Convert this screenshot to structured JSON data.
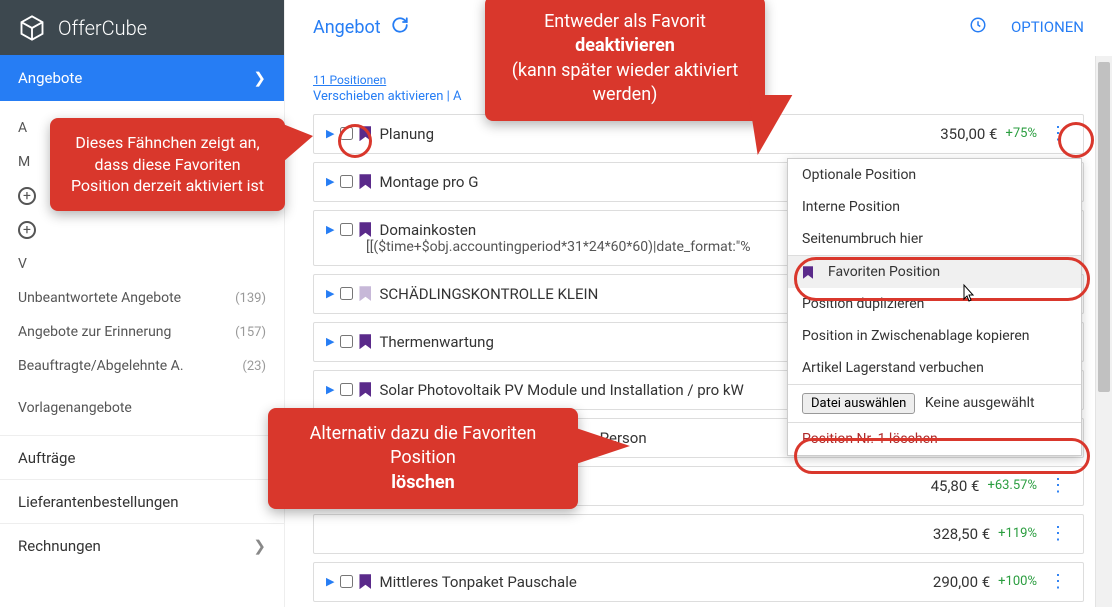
{
  "app": {
    "name": "OfferCube"
  },
  "sidebar": {
    "active": "Angebote",
    "sub": [
      {
        "label": "A",
        "count": ""
      },
      {
        "label": "M",
        "count": ""
      },
      {
        "label": "",
        "count": "",
        "icon": "plus"
      },
      {
        "label": "",
        "count": "",
        "icon": "plus"
      },
      {
        "label": "V",
        "count": ""
      },
      {
        "label": "Unbeantwortete Angebote",
        "count": "(139)"
      },
      {
        "label": "Angebote zur Erinnerung",
        "count": "(157)"
      },
      {
        "label": "Beauftragte/Abgelehnte A.",
        "count": "(23)"
      },
      {
        "label": "Vorlagenangebote",
        "count": ""
      }
    ],
    "plain": [
      "Aufträge",
      "Lieferantenbestellungen",
      "Rechnungen"
    ]
  },
  "header": {
    "title": "Angebot",
    "options": "OPTIONEN"
  },
  "positions": {
    "count_label": "11 Positionen",
    "links": "Verschieben aktivieren | A",
    "rows": [
      {
        "flag": "on",
        "title": "Planung",
        "price": "350,00 €",
        "pct": "+75%"
      },
      {
        "flag": "on",
        "title": "Montage pro G",
        "price": "",
        "pct": ""
      },
      {
        "flag": "on",
        "title": "Domainkosten",
        "tail": "[[($time+$obj.accountingperiod*31*24*60*60)|date_format:\"%",
        "price": "",
        "pct": ""
      },
      {
        "flag": "dim",
        "title": "SCHÄDLINGSKONTROLLE KLEIN",
        "price": "",
        "pct": ""
      },
      {
        "flag": "on",
        "title": "Thermenwartung",
        "price": "",
        "pct": ""
      },
      {
        "flag": "on",
        "title": "Solar Photovoltaik PV Module und Installation / pro kW",
        "price": "",
        "pct": ""
      },
      {
        "flag": "",
        "title": "pro Person",
        "price": "",
        "pct": ""
      },
      {
        "flag": "",
        "title": "",
        "price": "45,80 €",
        "pct": "+63.57%"
      },
      {
        "flag": "",
        "title": "",
        "price": "328,50 €",
        "pct": "+119%"
      },
      {
        "flag": "on",
        "title": "Mittleres Tonpaket Pauschale",
        "price": "290,00 €",
        "pct": "+100%"
      }
    ]
  },
  "context_menu": {
    "items": [
      "Optionale Position",
      "Interne Position",
      "Seitenumbruch hier"
    ],
    "fav": "Favoriten Position",
    "dup": "Position duplizieren",
    "copy": "Position in Zwischenablage kopieren",
    "stock": "Artikel Lagerstand verbuchen",
    "file_btn": "Datei auswählen",
    "file_none": "Keine ausgewählt",
    "del": "Position Nr. 1 löschen"
  },
  "callouts": {
    "c1": "Dieses Fähnchen zeigt an, dass diese Favoriten Position derzeit aktiviert ist",
    "c2_l1": "Entweder als Favorit",
    "c2_l2": "deaktivieren",
    "c2_l3": "(kann später wieder aktiviert werden)",
    "c3_l1": "Alternativ dazu die Favoriten Position",
    "c3_l2": "löschen"
  }
}
